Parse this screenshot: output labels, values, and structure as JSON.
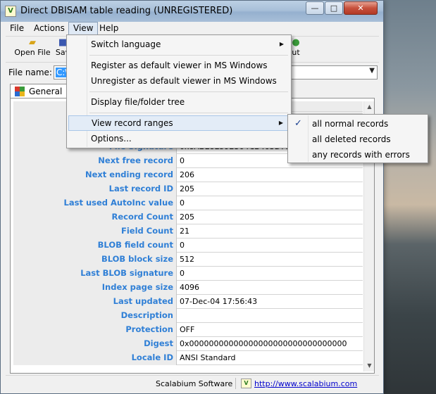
{
  "window": {
    "title": "Direct DBISAM table reading (UNREGISTERED)",
    "app_icon_text": "V",
    "minimize_glyph": "—",
    "maximize_glyph": "□",
    "close_glyph": "✕"
  },
  "menubar": {
    "file": "File",
    "actions": "Actions",
    "view": "View",
    "help": "Help"
  },
  "toolbar": {
    "open_label": "Open File",
    "save_label": "Sav",
    "about_label": "ut"
  },
  "filename": {
    "label": "File name:",
    "value": "C:\\"
  },
  "tab": {
    "label": "General In"
  },
  "table": {
    "rows": [
      {
        "label": "File Signature",
        "value": "0x8ABE8E592364CB403D71D2E"
      },
      {
        "label": "Next free record",
        "value": "0"
      },
      {
        "label": "Next ending record",
        "value": "206"
      },
      {
        "label": "Last record ID",
        "value": "205"
      },
      {
        "label": "Last used AutoInc value",
        "value": "0"
      },
      {
        "label": "Record Count",
        "value": "205"
      },
      {
        "label": "Field Count",
        "value": "21"
      },
      {
        "label": "BLOB field count",
        "value": "0"
      },
      {
        "label": "BLOB block size",
        "value": "512"
      },
      {
        "label": "Last BLOB signature",
        "value": "0"
      },
      {
        "label": "Index page size",
        "value": "4096"
      },
      {
        "label": "Last updated",
        "value": "07-Dec-04 17:56:43"
      },
      {
        "label": "Description",
        "value": ""
      },
      {
        "label": "Protection",
        "value": "OFF"
      },
      {
        "label": "Digest",
        "value": "0x00000000000000000000000000000000"
      },
      {
        "label": "Locale ID",
        "value": "ANSI Standard"
      }
    ]
  },
  "view_menu": {
    "items": [
      {
        "label": "Switch language",
        "has_submenu": true
      },
      {
        "label": "Register as default viewer in MS Windows"
      },
      {
        "label": "Unregister as default viewer in MS Windows"
      },
      {
        "label": "Display file/folder tree"
      },
      {
        "label": "View record ranges",
        "has_submenu": true,
        "highlighted": true
      },
      {
        "label": "Options..."
      }
    ],
    "arrow_glyph": "▶"
  },
  "record_ranges_submenu": {
    "items": [
      {
        "label": "all normal records",
        "checked": true
      },
      {
        "label": "all deleted records"
      },
      {
        "label": "any records with errors"
      }
    ],
    "check_glyph": "✓"
  },
  "statusbar": {
    "company": "Scalabium Software",
    "link": "http://www.scalabium.com",
    "logo_text": "V"
  },
  "colors": {
    "label_text": "#2f7fd6",
    "selection": "#3399ff",
    "menu_highlight": "#e3ecf7"
  }
}
